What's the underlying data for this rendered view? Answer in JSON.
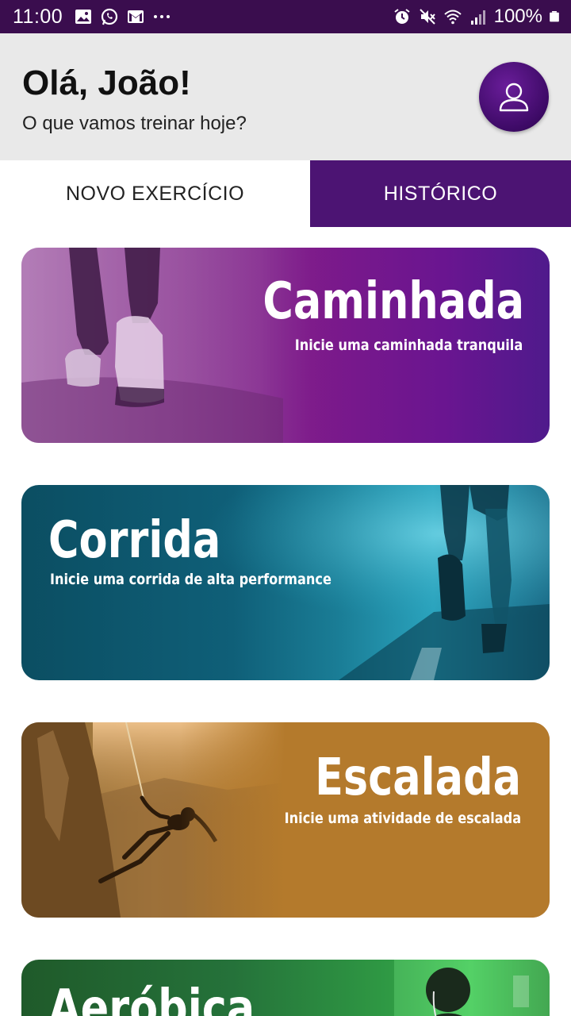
{
  "status_bar": {
    "time": "11:00",
    "battery": "100%",
    "left_icons": [
      "image-icon",
      "whatsapp-icon",
      "gmail-icon",
      "more-dots-icon"
    ],
    "right_icons": [
      "alarm-icon",
      "mute-icon",
      "wifi-icon",
      "signal-icon",
      "battery-icon"
    ]
  },
  "header": {
    "greeting": "Olá, João!",
    "subtitle": "O que vamos treinar hoje?",
    "avatar_icon": "user-icon"
  },
  "tabs": [
    {
      "label": "NOVO EXERCÍCIO",
      "active": true
    },
    {
      "label": "HISTÓRICO",
      "active": false
    }
  ],
  "cards": [
    {
      "title": "Caminhada",
      "description": "Inicie uma caminhada tranquila",
      "color": "#7d1a8a"
    },
    {
      "title": "Corrida",
      "description": "Inicie uma corrida de alta performance",
      "color": "#0f5f78"
    },
    {
      "title": "Escalada",
      "description": "Inicie uma atividade de escalada",
      "color": "#b07a2c"
    },
    {
      "title": "Aeróbica",
      "description": "",
      "color": "#2f9a44"
    }
  ],
  "colors": {
    "status_bar": "#3a0d4e",
    "header_bg": "#e9e9e9",
    "accent": "#4c1473"
  }
}
